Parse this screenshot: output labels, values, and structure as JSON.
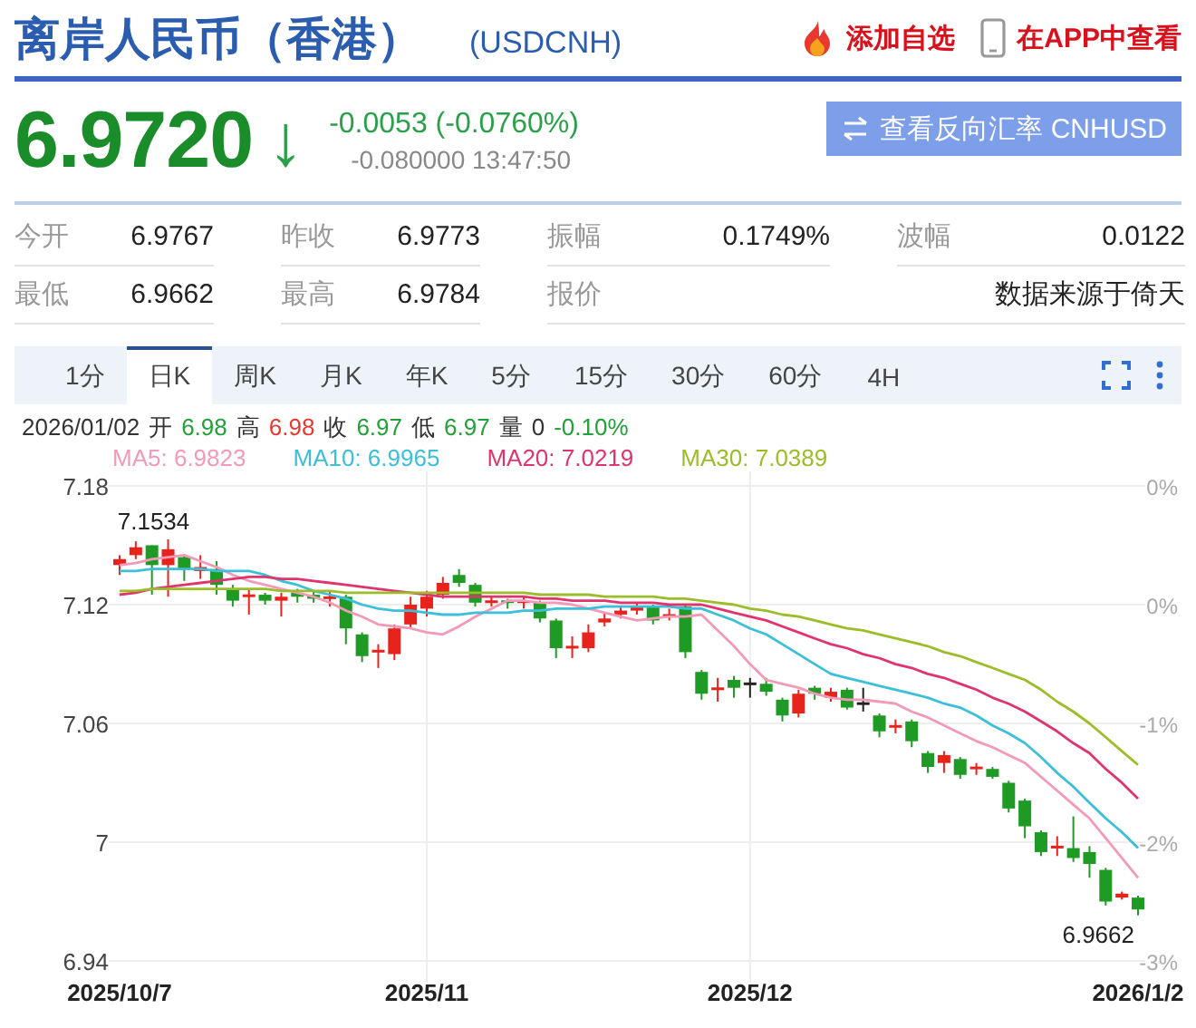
{
  "header": {
    "title": "离岸人民币（香港）",
    "code": "(USDCNH)",
    "actions": [
      {
        "kind": "fire",
        "label": "添加自选"
      },
      {
        "kind": "phone",
        "label": "在APP中查看"
      }
    ]
  },
  "quote": {
    "price": "6.9720",
    "arrow": "↓",
    "change": "-0.0053 (-0.0760%)",
    "detail": "-0.080000 13:47:50"
  },
  "reverse_button": {
    "label": "查看反向汇率 CNHUSD"
  },
  "stats": [
    [
      {
        "label": "今开",
        "value": "6.9767"
      },
      {
        "label": "昨收",
        "value": "6.9773"
      },
      {
        "label": "振幅",
        "value": "0.1749%"
      },
      {
        "label": "波幅",
        "value": "0.0122"
      }
    ],
    [
      {
        "label": "最低",
        "value": "6.9662"
      },
      {
        "label": "最高",
        "value": "6.9784"
      },
      {
        "label": "报价",
        "value": "数据来源于倚天"
      }
    ]
  ],
  "tabs": [
    {
      "label": "1分",
      "selected": false
    },
    {
      "label": "日K",
      "selected": true
    },
    {
      "label": "周K",
      "selected": false
    },
    {
      "label": "月K",
      "selected": false
    },
    {
      "label": "年K",
      "selected": false
    },
    {
      "label": "5分",
      "selected": false
    },
    {
      "label": "15分",
      "selected": false
    },
    {
      "label": "30分",
      "selected": false
    },
    {
      "label": "60分",
      "selected": false
    },
    {
      "label": "4H",
      "selected": false
    }
  ],
  "bar_info": {
    "date": "2026/01/02",
    "fields": [
      {
        "label": "开",
        "value": "6.98",
        "color": "#22a03a"
      },
      {
        "label": "高",
        "value": "6.98",
        "color": "#e8382f"
      },
      {
        "label": "收",
        "value": "6.97",
        "color": "#22a03a"
      },
      {
        "label": "低",
        "value": "6.97",
        "color": "#22a03a"
      },
      {
        "label": "量",
        "value": "0",
        "color": "#333333"
      }
    ],
    "change": {
      "value": "-0.10%",
      "color": "#22a03a"
    }
  },
  "ma_readings": [
    ": 6.9823",
    ": 6.9965",
    ": 7.0219",
    ": 7.0389"
  ],
  "chart": {
    "pct_ticks": [
      "0%",
      "0%",
      "-1%",
      "-2%",
      "-3%"
    ],
    "high_label": "7.1534",
    "low_label": "6.9662",
    "chart_data": {
      "type": "candlestick",
      "categories": [
        "2025/10/7",
        null,
        null,
        null,
        null,
        null,
        null,
        null,
        null,
        null,
        null,
        null,
        null,
        null,
        null,
        null,
        null,
        null,
        null,
        "2025/11",
        null,
        null,
        null,
        null,
        null,
        null,
        null,
        null,
        null,
        null,
        null,
        null,
        null,
        null,
        null,
        null,
        null,
        null,
        null,
        "2025/12",
        null,
        null,
        null,
        null,
        null,
        null,
        null,
        null,
        null,
        null,
        null,
        null,
        null,
        null,
        null,
        null,
        null,
        null,
        null,
        null,
        null,
        null,
        null,
        "2026/1/2"
      ],
      "ylim": [
        6.94,
        7.18
      ],
      "grid": true,
      "yticks": [
        7.18,
        7.12,
        7.06,
        7,
        6.94
      ],
      "ohlc": [
        [
          7.14,
          7.145,
          7.135,
          7.143
        ],
        [
          7.145,
          7.152,
          7.143,
          7.149
        ],
        [
          7.15,
          7.15,
          7.125,
          7.14
        ],
        [
          7.14,
          7.153,
          7.124,
          7.148
        ],
        [
          7.144,
          7.145,
          7.132,
          7.138
        ],
        [
          7.137,
          7.145,
          7.133,
          7.139
        ],
        [
          7.138,
          7.142,
          7.125,
          7.13
        ],
        [
          7.128,
          7.13,
          7.119,
          7.122
        ],
        [
          7.124,
          7.128,
          7.115,
          7.125
        ],
        [
          7.125,
          7.126,
          7.12,
          7.122
        ],
        [
          7.122,
          7.126,
          7.114,
          7.124
        ],
        [
          7.126,
          7.128,
          7.121,
          7.124
        ],
        [
          7.125,
          7.127,
          7.121,
          7.123
        ],
        [
          7.123,
          7.127,
          7.119,
          7.124
        ],
        [
          7.124,
          7.125,
          7.1,
          7.108
        ],
        [
          7.105,
          7.106,
          7.091,
          7.094
        ],
        [
          7.096,
          7.1,
          7.088,
          7.097
        ],
        [
          7.095,
          7.11,
          7.092,
          7.108
        ],
        [
          7.11,
          7.124,
          7.108,
          7.12
        ],
        [
          7.118,
          7.127,
          7.114,
          7.124
        ],
        [
          7.125,
          7.134,
          7.123,
          7.131
        ],
        [
          7.135,
          7.138,
          7.129,
          7.131
        ],
        [
          7.13,
          7.131,
          7.119,
          7.121
        ],
        [
          7.121,
          7.124,
          7.119,
          7.122
        ],
        [
          7.122,
          7.123,
          7.118,
          7.121
        ],
        [
          7.121,
          7.124,
          7.118,
          7.122
        ],
        [
          7.121,
          7.122,
          7.111,
          7.113
        ],
        [
          7.112,
          7.113,
          7.093,
          7.098
        ],
        [
          7.098,
          7.104,
          7.093,
          7.099
        ],
        [
          7.098,
          7.11,
          7.096,
          7.106
        ],
        [
          7.111,
          7.116,
          7.109,
          7.113
        ],
        [
          7.115,
          7.119,
          7.113,
          7.117
        ],
        [
          7.117,
          7.121,
          7.115,
          7.119
        ],
        [
          7.119,
          7.12,
          7.11,
          7.112
        ],
        [
          7.114,
          7.118,
          7.112,
          7.115
        ],
        [
          7.119,
          7.12,
          7.093,
          7.096
        ],
        [
          7.086,
          7.087,
          7.072,
          7.075
        ],
        [
          7.077,
          7.083,
          7.071,
          7.078
        ],
        [
          7.082,
          7.084,
          7.073,
          7.078
        ],
        [
          7.08,
          7.083,
          7.073,
          7.08
        ],
        [
          7.08,
          7.083,
          7.074,
          7.076
        ],
        [
          7.072,
          7.073,
          7.061,
          7.064
        ],
        [
          7.065,
          7.077,
          7.063,
          7.075
        ],
        [
          7.078,
          7.079,
          7.072,
          7.075
        ],
        [
          7.073,
          7.078,
          7.071,
          7.076
        ],
        [
          7.077,
          7.078,
          7.067,
          7.068
        ],
        [
          7.07,
          7.078,
          7.066,
          7.07
        ],
        [
          7.064,
          7.065,
          7.053,
          7.056
        ],
        [
          7.058,
          7.062,
          7.055,
          7.059
        ],
        [
          7.061,
          7.062,
          7.048,
          7.051
        ],
        [
          7.045,
          7.046,
          7.035,
          7.038
        ],
        [
          7.04,
          7.046,
          7.035,
          7.044
        ],
        [
          7.042,
          7.043,
          7.032,
          7.034
        ],
        [
          7.037,
          7.04,
          7.034,
          7.038
        ],
        [
          7.037,
          7.038,
          7.032,
          7.033
        ],
        [
          7.03,
          7.031,
          7.015,
          7.017
        ],
        [
          7.021,
          7.022,
          7.002,
          7.008
        ],
        [
          7.005,
          7.006,
          6.993,
          6.995
        ],
        [
          6.997,
          7.003,
          6.993,
          6.998
        ],
        [
          6.997,
          7.013,
          6.99,
          6.992
        ],
        [
          6.995,
          6.998,
          6.982,
          6.989
        ],
        [
          6.986,
          6.987,
          6.968,
          6.97
        ],
        [
          6.972,
          6.975,
          6.971,
          6.974
        ],
        [
          6.972,
          6.973,
          6.963,
          6.966
        ]
      ],
      "series": [
        {
          "name": "MA5",
          "type": "line",
          "color": "#f29ab8",
          "values": [
            7.14,
            7.141,
            7.143,
            7.144,
            7.145,
            7.142,
            7.139,
            7.135,
            7.132,
            7.13,
            7.128,
            7.126,
            7.124,
            7.121,
            7.117,
            7.114,
            7.11,
            7.109,
            7.108,
            7.106,
            7.105,
            7.109,
            7.114,
            7.118,
            7.122,
            7.122,
            7.121,
            7.121,
            7.12,
            7.118,
            7.116,
            7.114,
            7.112,
            7.113,
            7.114,
            7.114,
            7.115,
            7.107,
            7.099,
            7.09,
            7.082,
            7.08,
            7.078,
            7.075,
            7.073,
            7.072,
            7.072,
            7.071,
            7.07,
            7.066,
            7.063,
            7.059,
            7.055,
            7.051,
            7.048,
            7.044,
            7.04,
            7.033,
            7.026,
            7.019,
            7.012,
            7.002,
            6.992,
            6.982
          ]
        },
        {
          "name": "MA10",
          "type": "line",
          "color": "#3cbfd8",
          "values": [
            7.137,
            7.137,
            7.138,
            7.138,
            7.138,
            7.138,
            7.137,
            7.137,
            7.137,
            7.135,
            7.132,
            7.13,
            7.127,
            7.125,
            7.123,
            7.12,
            7.118,
            7.117,
            7.117,
            7.116,
            7.115,
            7.115,
            7.116,
            7.116,
            7.116,
            7.117,
            7.117,
            7.118,
            7.118,
            7.118,
            7.119,
            7.119,
            7.119,
            7.119,
            7.119,
            7.118,
            7.118,
            7.115,
            7.112,
            7.108,
            7.105,
            7.1,
            7.095,
            7.09,
            7.085,
            7.083,
            7.081,
            7.079,
            7.077,
            7.075,
            7.073,
            7.07,
            7.068,
            7.064,
            7.059,
            7.055,
            7.05,
            7.043,
            7.035,
            7.028,
            7.02,
            7.012,
            7.005,
            6.997
          ]
        },
        {
          "name": "MA20",
          "type": "line",
          "color": "#e0346e",
          "values": [
            7.125,
            7.126,
            7.128,
            7.129,
            7.13,
            7.131,
            7.132,
            7.133,
            7.134,
            7.134,
            7.133,
            7.133,
            7.132,
            7.131,
            7.13,
            7.129,
            7.128,
            7.127,
            7.126,
            7.125,
            7.124,
            7.124,
            7.124,
            7.124,
            7.124,
            7.124,
            7.123,
            7.123,
            7.122,
            7.122,
            7.122,
            7.121,
            7.121,
            7.121,
            7.12,
            7.12,
            7.12,
            7.118,
            7.116,
            7.114,
            7.112,
            7.109,
            7.106,
            7.103,
            7.1,
            7.098,
            7.095,
            7.093,
            7.09,
            7.088,
            7.085,
            7.083,
            7.08,
            7.077,
            7.073,
            7.07,
            7.066,
            7.061,
            7.056,
            7.05,
            7.045,
            7.037,
            7.03,
            7.022
          ]
        },
        {
          "name": "MA30",
          "type": "line",
          "color": "#9cbd2a",
          "values": [
            7.127,
            7.127,
            7.128,
            7.128,
            7.128,
            7.128,
            7.128,
            7.128,
            7.128,
            7.128,
            7.127,
            7.127,
            7.127,
            7.127,
            7.126,
            7.126,
            7.126,
            7.126,
            7.126,
            7.126,
            7.126,
            7.126,
            7.126,
            7.126,
            7.126,
            7.126,
            7.125,
            7.125,
            7.125,
            7.125,
            7.124,
            7.124,
            7.124,
            7.124,
            7.123,
            7.123,
            7.122,
            7.121,
            7.12,
            7.118,
            7.117,
            7.115,
            7.114,
            7.112,
            7.11,
            7.108,
            7.107,
            7.105,
            7.103,
            7.101,
            7.099,
            7.096,
            7.094,
            7.091,
            7.088,
            7.085,
            7.082,
            7.077,
            7.071,
            7.066,
            7.06,
            7.053,
            7.046,
            7.039
          ]
        }
      ]
    }
  }
}
